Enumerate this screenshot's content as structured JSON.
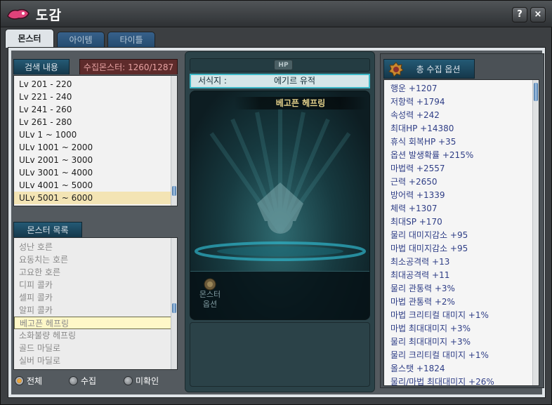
{
  "window": {
    "title": "도감",
    "help_label": "?",
    "close_label": "×"
  },
  "tabs": [
    {
      "label": "몬스터",
      "active": true
    },
    {
      "label": "아이템",
      "active": false
    },
    {
      "label": "타이틀",
      "active": false
    }
  ],
  "search": {
    "title": "검색 내용",
    "collected_label": "수집몬스터: 1260/1287",
    "items": [
      "Lv 201 - 220",
      "Lv 221 - 240",
      "Lv 241 - 260",
      "Lv 261 - 280",
      "ULv 1 ~ 1000",
      "ULv 1001 ~ 2000",
      "ULv 2001 ~ 3000",
      "ULv 3001 ~ 4000",
      "ULv 4001 ~ 5000",
      "ULv 5001 ~ 6000"
    ],
    "selected_index": 9
  },
  "monster_list": {
    "title": "몬스터 목록",
    "items": [
      "성난 호른",
      "요동치는 호른",
      "고요한 호른",
      "디피 콜카",
      "셀피 콜카",
      "알피 콜카",
      "베고픈 헤프링",
      "소화불량 헤프링",
      "골드 마딜로",
      "실버 마딜로"
    ],
    "highlight_index": 6
  },
  "filters": [
    {
      "label": "전체",
      "selected": true
    },
    {
      "label": "수집",
      "selected": false
    },
    {
      "label": "미확인",
      "selected": false
    }
  ],
  "detail": {
    "hp_label": "HP",
    "habitat_label": "서식지 :",
    "habitat_value": "에기르 유적",
    "monster_name": "베고픈 헤프링",
    "option_label": "몬스터 옵션"
  },
  "options": {
    "title": "총 수집 옵션",
    "items": [
      "행운 +1207",
      "저항력 +1794",
      "속성력 +242",
      "최대HP +14380",
      "휴식 회복HP +35",
      "옵션 발생확률 +215%",
      "마법력 +2557",
      "근력 +2650",
      "방어력 +1339",
      "체력 +1307",
      "최대SP +170",
      "물리 대미지감소 +95",
      "마법 대미지감소 +95",
      "최소공격력 +13",
      "최대공격력 +11",
      "물리 관통력 +3%",
      "마법 관통력 +2%",
      "마법 크리티컬 대미지 +1%",
      "마법 최대대미지 +3%",
      "물리 최대대미지 +3%",
      "물리 크리티컬 대미지 +1%",
      "올스탯 +1824",
      "물리/마법 최대대미지 +26%"
    ]
  },
  "colors": {
    "accent_teal": "#3fb8c7",
    "option_text": "#2f3e86",
    "count_badge": "#5e2b2b"
  }
}
